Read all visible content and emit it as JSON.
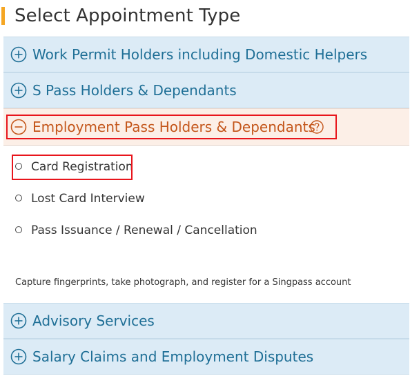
{
  "page": {
    "title": "Select Appointment Type"
  },
  "accordion": [
    {
      "label": "Work Permit Holders including Domestic Helpers",
      "state": "collapsed",
      "icon": "plus-circle-icon"
    },
    {
      "label": "S Pass Holders & Dependants",
      "state": "collapsed",
      "icon": "plus-circle-icon"
    },
    {
      "label": "Employment Pass Holders & Dependants",
      "state": "expanded",
      "icon": "minus-circle-icon",
      "help_icon": "question-circle-icon"
    },
    {
      "label": "Advisory Services",
      "state": "collapsed",
      "icon": "plus-circle-icon"
    },
    {
      "label": "Salary Claims and Employment Disputes",
      "state": "collapsed",
      "icon": "plus-circle-icon"
    }
  ],
  "options": [
    {
      "label": "Card Registration",
      "selected": false
    },
    {
      "label": "Lost Card Interview",
      "selected": false
    },
    {
      "label": "Pass Issuance / Renewal / Cancellation",
      "selected": false
    }
  ],
  "description": "Capture fingerprints, take photograph, and register for a Singpass account",
  "colors": {
    "accent_bar": "#f5a623",
    "collapsed_header_bg": "#dcebf6",
    "collapsed_text": "#1f6f96",
    "expanded_header_bg": "#fcefe7",
    "expanded_text": "#c4561b",
    "highlight": "#e8151c"
  }
}
